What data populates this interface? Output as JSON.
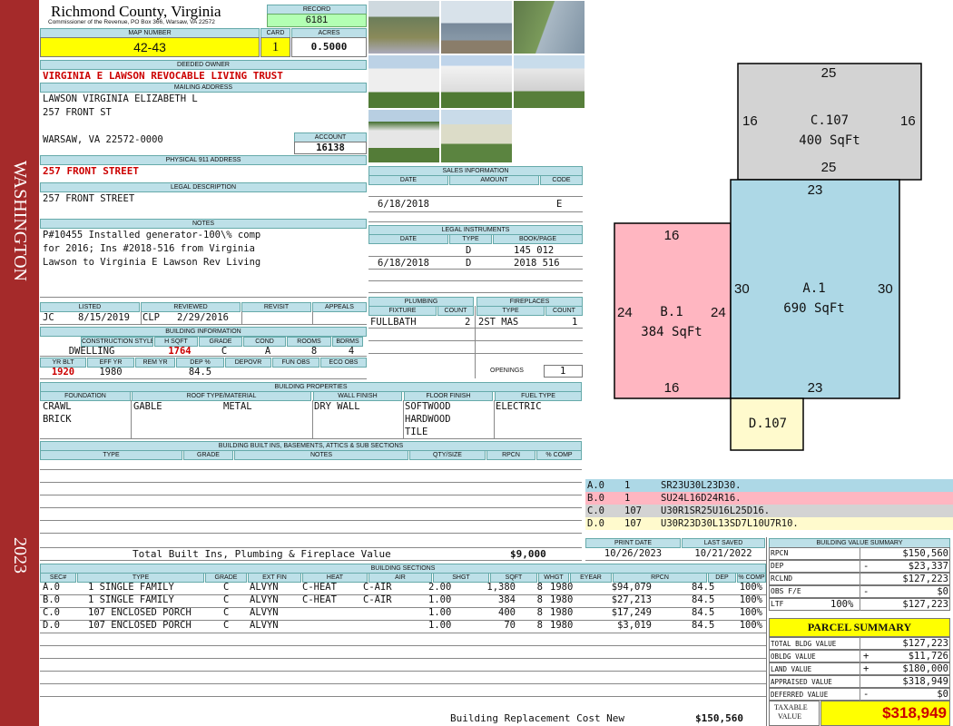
{
  "side": {
    "top": "WASHINGTON",
    "bottom": "2023"
  },
  "header": {
    "county": "Richmond County, Virginia",
    "commissioner": "Commissioner of the Revenue, PO Box 366, Warsaw, VA 22572",
    "record_label": "RECORD",
    "record": "6181",
    "map_label": "MAP NUMBER",
    "map": "42-43",
    "card_label": "CARD",
    "card": "1",
    "acres_label": "ACRES",
    "acres": "0.5000"
  },
  "owner": {
    "label": "DEEDED OWNER",
    "name": "VIRGINIA E LAWSON REVOCABLE LIVING TRUST",
    "mail_label": "MAILING ADDRESS",
    "mail1": "LAWSON VIRGINIA ELIZABETH L",
    "mail2": "257 FRONT ST",
    "mail3": "WARSAW, VA 22572-0000",
    "account_label": "ACCOUNT",
    "account": "16138",
    "phys_label": "PHYSICAL 911 ADDRESS",
    "phys": "257 FRONT STREET",
    "legal_label": "LEGAL DESCRIPTION",
    "legal": "257 FRONT STREET",
    "notes_label": "NOTES",
    "notes1": "P#10455 Installed generator-100\\% comp",
    "notes2": "for 2016; Ins #2018-516 from Virginia",
    "notes3": "Lawson to Virginia E Lawson Rev Living"
  },
  "review": {
    "listed_label": "LISTED",
    "listed_by": "JC",
    "listed": "8/15/2019",
    "reviewed_label": "REVIEWED",
    "reviewed_by": "CLP",
    "reviewed": "2/29/2016",
    "revisit_label": "REVISIT",
    "appeals_label": "APPEALS"
  },
  "building": {
    "label": "BUILDING INFORMATION",
    "h": [
      "CONSTRUCTION STYLE",
      "H SQFT",
      "GRADE",
      "COND",
      "ROOMS",
      "BDRMS"
    ],
    "v": [
      "DWELLING",
      "1764",
      "C",
      "A",
      "8",
      "4"
    ],
    "h2": [
      "YR BLT",
      "EFF YR",
      "REM YR",
      "DEP %",
      "DEPOVR",
      "FUN OBS",
      "ECO OBS"
    ],
    "v2": [
      "1920",
      "1980",
      "",
      "84.5",
      "",
      "",
      ""
    ]
  },
  "props": {
    "label": "BUILDING PROPERTIES",
    "h": [
      "FOUNDATION",
      "ROOF TYPE/MATERIAL",
      "WALL FINISH",
      "FLOOR FINISH",
      "FUEL TYPE"
    ],
    "foundation": [
      "CRAWL",
      "BRICK"
    ],
    "roof_type": "GABLE",
    "roof_mat": "METAL",
    "wall": "DRY WALL",
    "floor": [
      "SOFTWOOD",
      "HARDWOOD",
      "TILE"
    ],
    "fuel": "ELECTRIC"
  },
  "builtins": {
    "label": "BUILDING BUILT INS, BASEMENTS, ATTICS & SUB SECTIONS",
    "h": [
      "TYPE",
      "GRADE",
      "NOTES",
      "QTY/SIZE",
      "RPCN",
      "% COMP"
    ],
    "total_label": "Total Built Ins, Plumbing & Fireplace Value",
    "total": "$9,000"
  },
  "sales": {
    "label": "SALES INFORMATION",
    "h": [
      "DATE",
      "AMOUNT",
      "CODE"
    ],
    "date": "6/18/2018",
    "code": "E"
  },
  "instruments": {
    "label": "LEGAL INSTRUMENTS",
    "h": [
      "DATE",
      "TYPE",
      "BOOK/PAGE"
    ],
    "rows": [
      {
        "date": "",
        "type": "D",
        "bp": "145 012"
      },
      {
        "date": "6/18/2018",
        "type": "D",
        "bp": "2018 516"
      }
    ]
  },
  "plumbing": {
    "label": "PLUMBING",
    "h": [
      "FIXTURE",
      "COUNT"
    ],
    "fixture": "FULLBATH",
    "count": "2"
  },
  "fireplaces": {
    "label": "FIREPLACES",
    "h": [
      "TYPE",
      "COUNT"
    ],
    "type": "2ST MAS",
    "count": "1",
    "openings_label": "OPENINGS",
    "openings": "1"
  },
  "sketch": {
    "A": {
      "name": "A.1",
      "area": "690 SqFt",
      "top": "23",
      "bottom": "23",
      "left": "30",
      "right": "30"
    },
    "B": {
      "name": "B.1",
      "area": "384 SqFt",
      "top": "16",
      "bottom": "16",
      "left": "24",
      "right": "24"
    },
    "C": {
      "name": "C.107",
      "area": "400 SqFt",
      "top": "25",
      "bottom": "25",
      "left": "16",
      "right": "16"
    },
    "D": {
      "name": "D.107"
    }
  },
  "legend": [
    {
      "id": "A.0",
      "n": "1",
      "code": "SR23U30L23D30.",
      "color": "#add8e6"
    },
    {
      "id": "B.0",
      "n": "1",
      "code": "SU24L16D24R16.",
      "color": "#ffb6c1"
    },
    {
      "id": "C.0",
      "n": "107",
      "code": "U30R1SR25U16L25D16.",
      "color": "#d3d3d3"
    },
    {
      "id": "D.0",
      "n": "107",
      "code": "U30R23D30L13SD7L10U7R10.",
      "color": "#fffacd"
    }
  ],
  "dates": {
    "print_label": "PRINT DATE",
    "print": "10/26/2023",
    "saved_label": "LAST SAVED",
    "saved": "10/21/2022"
  },
  "sections": {
    "label": "BUILDING SECTIONS",
    "h": [
      "SEC#",
      "TYPE",
      "GRADE",
      "EXT FIN",
      "HEAT",
      "AIR",
      "SHGT",
      "SQFT",
      "WHGT",
      "EYEAR",
      "RPCN",
      "DEP",
      "% COMP"
    ],
    "rows": [
      [
        "A.0",
        "1 SINGLE FAMILY",
        "C",
        "ALVYN",
        "C-HEAT",
        "C-AIR",
        "2.00",
        "1,380",
        "8",
        "1980",
        "$94,079",
        "84.5",
        "100%"
      ],
      [
        "B.0",
        "1 SINGLE FAMILY",
        "C",
        "ALVYN",
        "C-HEAT",
        "C-AIR",
        "1.00",
        "384",
        "8",
        "1980",
        "$27,213",
        "84.5",
        "100%"
      ],
      [
        "C.0",
        "107 ENCLOSED PORCH",
        "C",
        "ALVYN",
        "",
        "",
        "1.00",
        "400",
        "8",
        "1980",
        "$17,249",
        "84.5",
        "100%"
      ],
      [
        "D.0",
        "107 ENCLOSED PORCH",
        "C",
        "ALVYN",
        "",
        "",
        "1.00",
        "70",
        "8",
        "1980",
        "$3,019",
        "84.5",
        "100%"
      ]
    ],
    "brcn_label": "Building Replacement Cost New",
    "brcn": "$150,560"
  },
  "bvs": {
    "label": "BUILDING VALUE SUMMARY",
    "rows": [
      [
        "RPCN",
        "",
        "$150,560"
      ],
      [
        "DEP",
        "-",
        "$23,337"
      ],
      [
        "RCLND",
        "",
        "$127,223"
      ],
      [
        "OBS F/E",
        "-",
        "$0"
      ],
      [
        "LTF",
        "100%",
        "$127,223"
      ]
    ]
  },
  "parcel": {
    "label": "PARCEL SUMMARY",
    "rows": [
      [
        "TOTAL BLDG VALUE",
        "",
        "$127,223"
      ],
      [
        "OBLDG VALUE",
        "+",
        "$11,726"
      ],
      [
        "LAND VALUE",
        "+",
        "$180,000"
      ],
      [
        "APPRAISED VALUE",
        "",
        "$318,949"
      ],
      [
        "DEFERRED VALUE",
        "-",
        "$0"
      ]
    ],
    "taxable_label1": "TAXABLE",
    "taxable_label2": "VALUE",
    "taxable": "$318,949"
  }
}
